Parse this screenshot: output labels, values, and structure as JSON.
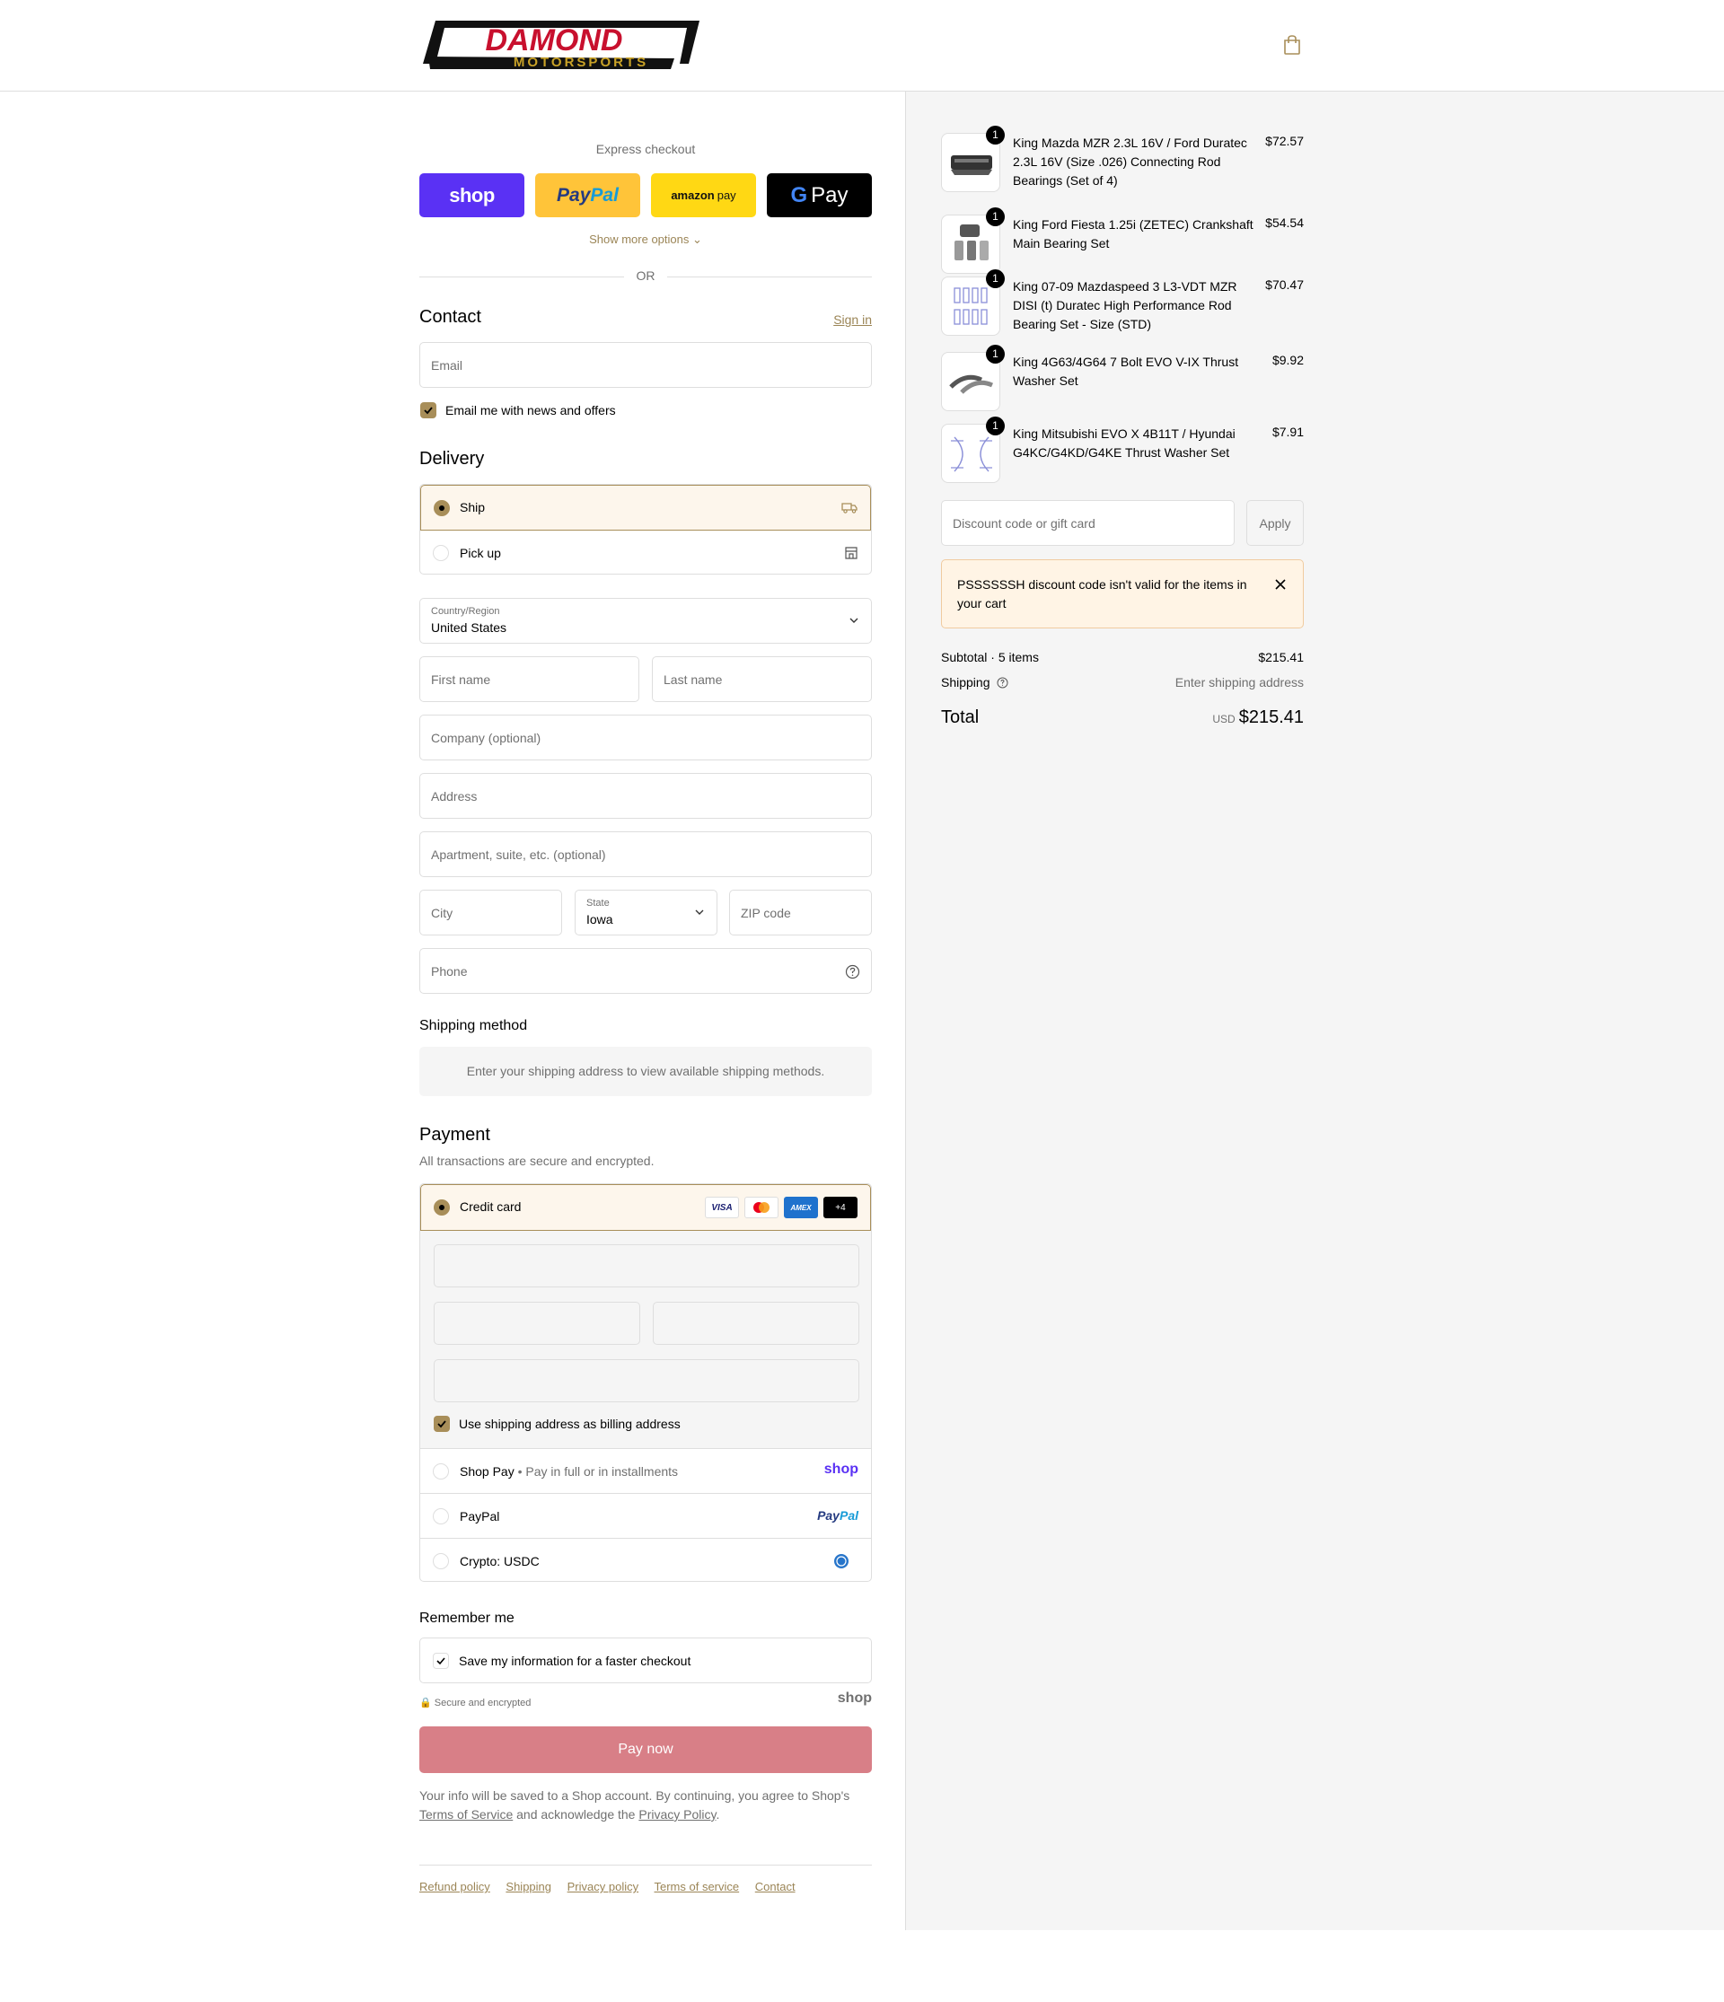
{
  "brand": {
    "line1": "DAMOND",
    "line2": "MOTORSPORTS"
  },
  "express": {
    "title": "Express checkout",
    "shop": "shop",
    "paypal_a": "Pay",
    "paypal_b": "Pal",
    "amazon_a": "amazon",
    "amazon_b": "pay",
    "gpay_g": "G",
    "gpay": "Pay",
    "show_more": "Show more options",
    "or": "OR"
  },
  "contact": {
    "title": "Contact",
    "sign_in": "Sign in",
    "email_placeholder": "Email",
    "news_label": "Email me with news and offers"
  },
  "delivery": {
    "title": "Delivery",
    "ship": "Ship",
    "pickup": "Pick up",
    "country_label": "Country/Region",
    "country": "United States",
    "first_name": "First name",
    "last_name": "Last name",
    "company": "Company (optional)",
    "address": "Address",
    "apartment": "Apartment, suite, etc. (optional)",
    "city": "City",
    "state_label": "State",
    "state": "Iowa",
    "zip": "ZIP code",
    "phone": "Phone"
  },
  "shipping_method": {
    "title": "Shipping method",
    "notice": "Enter your shipping address to view available shipping methods."
  },
  "payment": {
    "title": "Payment",
    "subtitle": "All transactions are secure and encrypted.",
    "credit_card": "Credit card",
    "brands": [
      "VISA",
      "AMEX",
      "+4"
    ],
    "billing_same": "Use shipping address as billing address",
    "shop_pay": "Shop Pay",
    "shop_pay_sub": "Pay in full or in installments",
    "shop_logo": "shop",
    "paypal": "PayPal",
    "paypal_logo_a": "Pay",
    "paypal_logo_b": "Pal",
    "crypto": "Crypto: USDC"
  },
  "remember": {
    "title": "Remember me",
    "save": "Save my information for a faster checkout",
    "secure": "Secure and encrypted",
    "shop_logo": "shop"
  },
  "pay_now": "Pay now",
  "legal": {
    "a": "Your info will be saved to a Shop account. By continuing, you agree to Shop's",
    "tos": "Terms of Service",
    "b": "and acknowledge the",
    "privacy": "Privacy Policy",
    "c": "."
  },
  "footer": [
    "Refund policy",
    "Shipping",
    "Privacy policy",
    "Terms of service",
    "Contact"
  ],
  "order": {
    "items": [
      {
        "name": "King Mazda MZR 2.3L 16V / Ford Duratec 2.3L 16V (Size .026) Connecting Rod Bearings (Set of 4)",
        "price": "$72.57",
        "qty": "1"
      },
      {
        "name": "King Ford Fiesta 1.25i (ZETEC) Crankshaft Main Bearing Set",
        "price": "$54.54",
        "qty": "1"
      },
      {
        "name": "King 07-09 Mazdaspeed 3 L3-VDT MZR DISI (t) Duratec High Performance Rod Bearing Set - Size (STD)",
        "price": "$70.47",
        "qty": "1"
      },
      {
        "name": "King 4G63/4G64 7 Bolt EVO V-IX Thrust Washer Set",
        "price": "$9.92",
        "qty": "1"
      },
      {
        "name": "King Mitsubishi EVO X 4B11T / Hyundai G4KC/G4KD/G4KE Thrust Washer Set",
        "price": "$7.91",
        "qty": "1"
      }
    ],
    "discount_placeholder": "Discount code or gift card",
    "apply": "Apply",
    "error": "PSSSSSSH discount code isn't valid for the items in your cart",
    "subtotal_label": "Subtotal · 5 items",
    "subtotal": "$215.41",
    "shipping_label": "Shipping",
    "shipping_value": "Enter shipping address",
    "total_label": "Total",
    "currency": "USD",
    "total": "$215.41"
  },
  "colors": {
    "accent": "#a88e59",
    "link": "#9b8556",
    "pay_button": "#d87f87",
    "error_bg": "#fff4e5"
  }
}
